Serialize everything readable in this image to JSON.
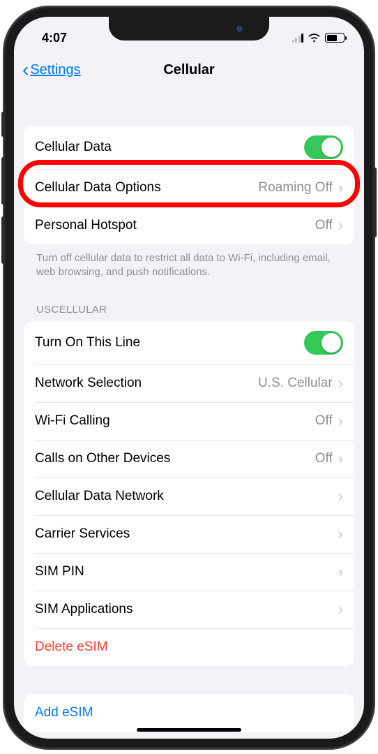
{
  "status": {
    "time": "4:07"
  },
  "nav": {
    "back": "Settings",
    "title": "Cellular"
  },
  "group1": {
    "cellular_data": "Cellular Data",
    "data_options": "Cellular Data Options",
    "data_options_detail": "Roaming Off",
    "hotspot": "Personal Hotspot",
    "hotspot_detail": "Off"
  },
  "footer1": "Turn off cellular data to restrict all data to Wi-Fi, including email, web browsing, and push notifications.",
  "header2": "USCELLULAR",
  "group2": {
    "turn_on_line": "Turn On This Line",
    "network_selection": "Network Selection",
    "network_selection_detail": "U.S. Cellular",
    "wifi_calling": "Wi-Fi Calling",
    "wifi_calling_detail": "Off",
    "calls_other": "Calls on Other Devices",
    "calls_other_detail": "Off",
    "cdn": "Cellular Data Network",
    "carrier_services": "Carrier Services",
    "sim_pin": "SIM PIN",
    "sim_apps": "SIM Applications",
    "delete_esim": "Delete eSIM"
  },
  "group3": {
    "add_esim": "Add eSIM"
  }
}
